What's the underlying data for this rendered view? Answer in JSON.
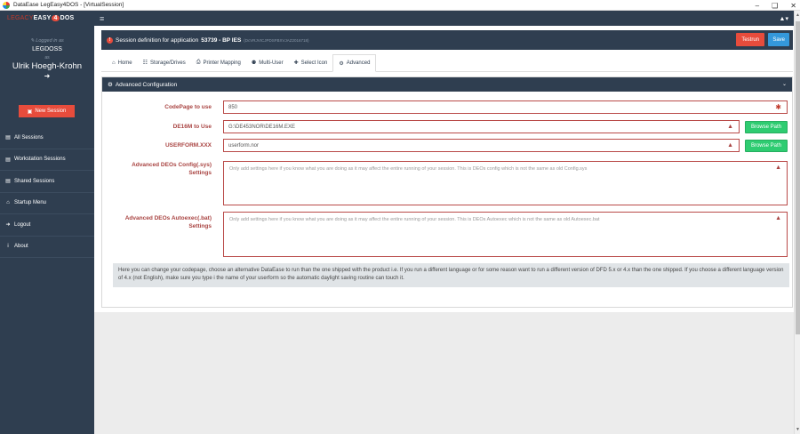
{
  "window": {
    "title": "DataEase LegEasy4DOS - [VirtualSession]",
    "controls": [
      "–",
      "❑",
      "✕"
    ]
  },
  "topbar": {
    "logo_prefix": "LEGACY",
    "logo_mid": "EASY",
    "logo_four": "4",
    "logo_suffix": "DOS",
    "hamburger": "≡",
    "user_menu": "▲▾"
  },
  "sidebar": {
    "logged_in_as": "✎ Logged in as",
    "instance": "LEGDOSS",
    "as_label": "as",
    "user_name": "Ulrik Hoegh-Krohn",
    "logout_icon": "➜",
    "new_session_label": "New Session",
    "new_session_icon": "▣",
    "items": [
      {
        "label": "All Sessions",
        "icon": "▤"
      },
      {
        "label": "Workstation Sessions",
        "icon": "▤"
      },
      {
        "label": "Shared Sessions",
        "icon": "▤"
      },
      {
        "label": "Startup Menu",
        "icon": "⌂"
      },
      {
        "label": "Logout",
        "icon": "➜"
      },
      {
        "label": "About",
        "icon": "i"
      }
    ]
  },
  "session": {
    "badge": "!",
    "title_prefix": "Session definition for application",
    "app_code": "53739 - BP IES",
    "session_id": "(DcVRJVICJPDSFBXVJAZ2016718)",
    "testrun_label": "Testrun",
    "save_label": "Save"
  },
  "tabs": [
    {
      "label": "Home",
      "icon": "⌂",
      "active": false
    },
    {
      "label": "Storage/Drives",
      "icon": "☷",
      "active": false
    },
    {
      "label": "Printer Mapping",
      "icon": "⎙",
      "active": false
    },
    {
      "label": "Multi-User",
      "icon": "⚉",
      "active": false
    },
    {
      "label": "Select Icon",
      "icon": "✚",
      "active": false
    },
    {
      "label": "Advanced",
      "icon": "⚙",
      "active": true
    }
  ],
  "config": {
    "header": "Advanced Configuration",
    "header_icon": "⚙",
    "chevron": "⌄",
    "codepage": {
      "label": "CodePage to use",
      "value": "850",
      "icon": "✱"
    },
    "de16m": {
      "label": "DE16M to Use",
      "value": "G:\\DE453NOR\\DE16M.EXE",
      "icon": "▲",
      "browse": "Browse Path"
    },
    "userform": {
      "label": "USERFORM.XXX",
      "value": "userform.nor",
      "icon": "▲",
      "browse": "Browse Path"
    },
    "config_sys": {
      "label_line1": "Advanced DEOs Config(.sys)",
      "label_line2": "Settings",
      "placeholder": "Only add settings here if you know what you are doing as it may affect the entire running of your session. This is DEOs config which is not the same as old Config.sys",
      "icon": "▲"
    },
    "autoexec": {
      "label_line1": "Advanced DEOs Autoexec(.bat)",
      "label_line2": "Settings",
      "placeholder": "Only add settings here if you know what you are doing as it may affect the entire running of your session. This is DEOs Autoexec which is not the same as old Autoexec.bat",
      "icon": "▲"
    },
    "help_text": "Here you can change your codepage, choose an alternative DataEase to run than the one shipped with the product i.e. If you run a different language or for some reason want to run a different version of DFD 5.x or 4.x than the one shipped. If you choose a different language version of 4.x (not English), make sure you type i the name of your userform so the automatic daylight saving routine can touch it."
  },
  "scrollbar": {
    "up": "▲",
    "down": "▼"
  }
}
